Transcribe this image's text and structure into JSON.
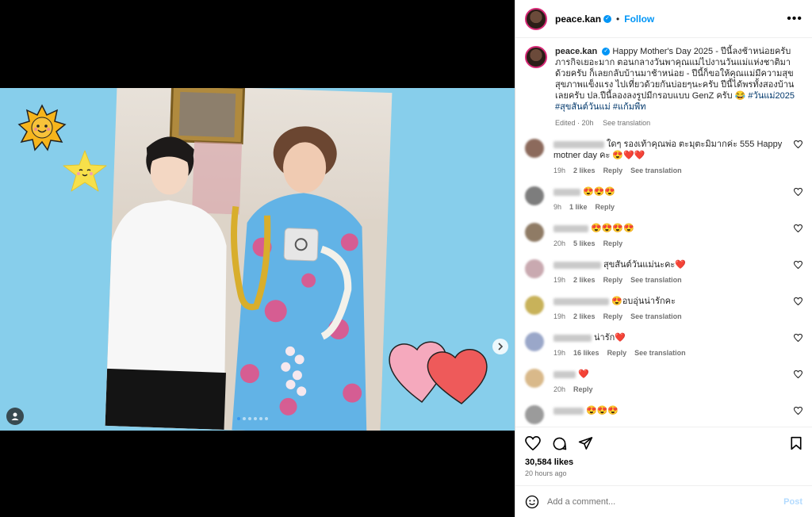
{
  "header": {
    "username": "peace.kan",
    "separator": "•",
    "follow_label": "Follow",
    "more_label": "•••"
  },
  "caption": {
    "username": "peace.kan",
    "text": "Happy Mother's Day 2025 - ปีนี้ลงช้าหน่อยครับ ภารกิจเยอะมาก ตอนกลางวันพาคุณแม่ไปงานวันแม่แห่งชาติมาด้วยครับ ก็เลยกลับบ้านมาช้าหน่อย - ปีนี้ก็ขอให้คุณแม่มีความสุข สุขภาพแข็งแรง ไปเที่ยวด้วยกันบ่อยๆนะครับ ปีนี้ได้พรทั้งสองบ้านเลยครับ ปล.ปีนี้ลองลงรูปมีกรอบแบบ GenZ ครับ 😂",
    "hashtags": "#วันแม่2025 #สุขสันต์วันแม่ #แก้มพีท",
    "edited": "Edited · 20h",
    "see_translation": "See translation"
  },
  "comments": [
    {
      "text": "ใดๆ รองเท้าคุณพ่อ ตะมุตะมิมากค่ะ 555 Happy motner day คะ 😍❤️❤️",
      "time": "19h",
      "likes": "2 likes",
      "reply": "Reply",
      "translate": "See translation",
      "avatar_color": "#8c6a5c"
    },
    {
      "text": "😍😍😍",
      "time": "9h",
      "likes": "1 like",
      "reply": "Reply",
      "translate": "",
      "avatar_color": "#7d7d7d"
    },
    {
      "text": "😍😍😍😍",
      "time": "20h",
      "likes": "5 likes",
      "reply": "Reply",
      "translate": "",
      "avatar_color": "#8f7b65"
    },
    {
      "text": "สุขสันต์วันแม่นะคะ❤️",
      "time": "19h",
      "likes": "2 likes",
      "reply": "Reply",
      "translate": "See translation",
      "avatar_color": "#c9a9b0"
    },
    {
      "text": "😍อบอุ่นน่ารักคะ",
      "time": "19h",
      "likes": "2 likes",
      "reply": "Reply",
      "translate": "See translation",
      "avatar_color": "#c8b25a"
    },
    {
      "text": "น่ารัก❤️",
      "time": "19h",
      "likes": "16 likes",
      "reply": "Reply",
      "translate": "See translation",
      "avatar_color": "#9aa7c9"
    },
    {
      "text": "❤️",
      "time": "20h",
      "likes": "",
      "reply": "Reply",
      "translate": "",
      "avatar_color": "#d9b98a"
    },
    {
      "text": "😍😍😍",
      "time": "",
      "likes": "",
      "reply": "",
      "translate": "",
      "avatar_color": "#9b9b9b"
    }
  ],
  "actions": {
    "likes": "30,584 likes",
    "time_ago": "20 hours ago"
  },
  "add_comment": {
    "placeholder": "Add a comment...",
    "post_label": "Post"
  },
  "carousel": {
    "slide_count": 6,
    "active_index": 0
  },
  "colors": {
    "accent": "#0095f6",
    "background_blue": "#87ceeb",
    "hashtag": "#00376b"
  }
}
